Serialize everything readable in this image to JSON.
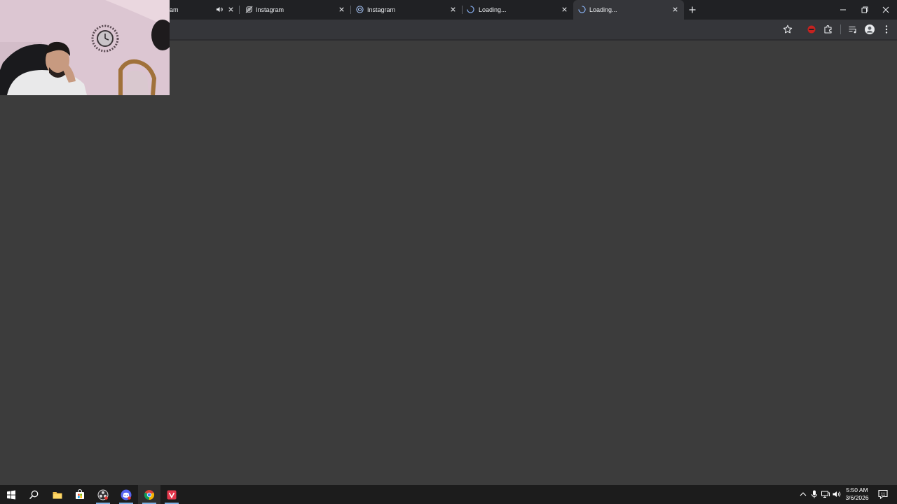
{
  "browser": {
    "tabs": [
      {
        "title": "am",
        "audio": true,
        "favicon": "instagram-icon"
      },
      {
        "title": "Instagram",
        "favicon": "instagram-muted-icon"
      },
      {
        "title": "Instagram",
        "favicon": "instagram-icon"
      },
      {
        "title": "Loading...",
        "favicon": "loading-spinner-icon"
      },
      {
        "title": "Loading...",
        "favicon": "loading-spinner-icon",
        "active": true
      }
    ],
    "toolbar_icons": [
      "bookmark-star-icon",
      "extension-red-icon",
      "extensions-puzzle-icon",
      "media-control-icon",
      "profile-avatar-icon",
      "kebab-menu-icon"
    ]
  },
  "webcam": {
    "description_icon": "webcam-feed"
  },
  "taskbar": {
    "apps": [
      "start-icon",
      "search-icon",
      "file-explorer-icon",
      "microsoft-store-icon",
      "obs-icon",
      "discord-icon",
      "chrome-icon",
      "video-editor-icon"
    ],
    "clock": {
      "time": "5:50 AM",
      "date": "3/6/2026"
    },
    "notification_count": "11"
  },
  "colors": {
    "tabstrip": "#202124",
    "toolbar": "#35363a",
    "content": "#3c3c3c",
    "taskbar": "#1c1c1c",
    "accent": "#8ab4f8"
  }
}
